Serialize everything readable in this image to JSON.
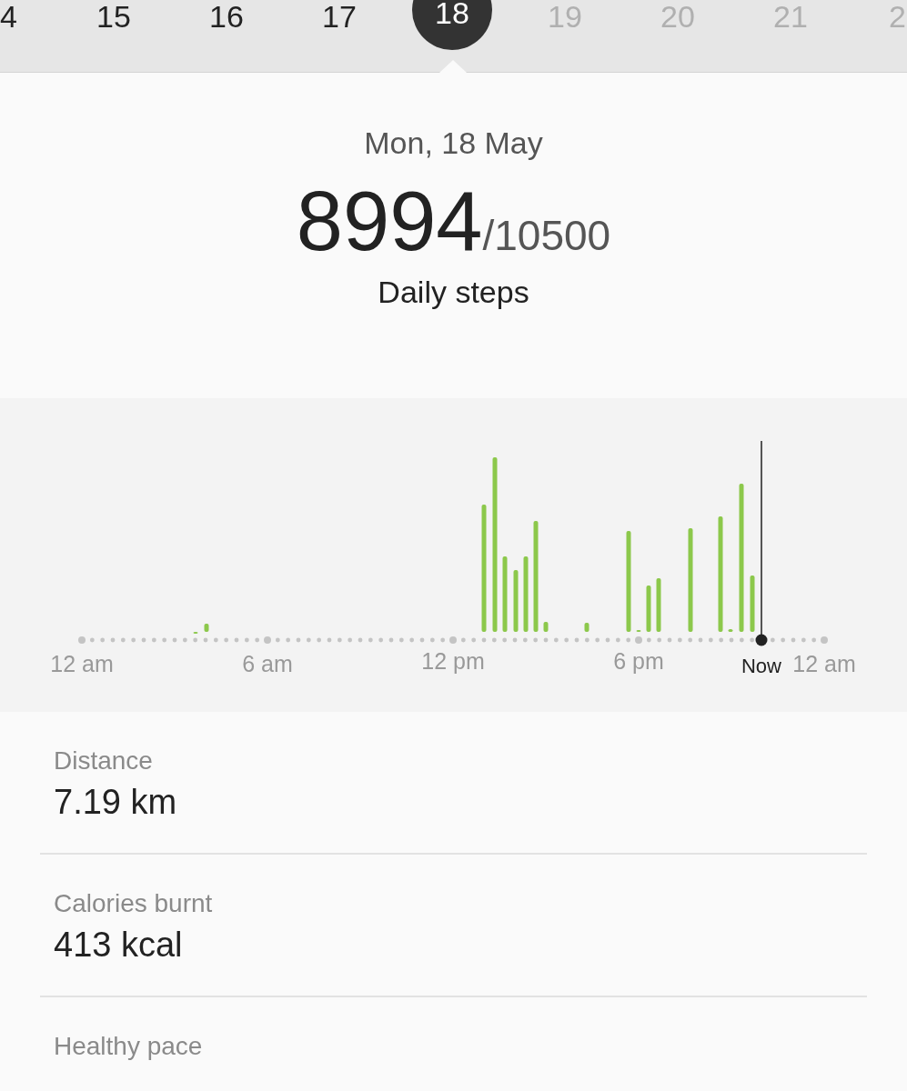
{
  "date_strip": [
    {
      "label": "4",
      "selected": false,
      "future": false
    },
    {
      "label": "15",
      "selected": false,
      "future": false
    },
    {
      "label": "16",
      "selected": false,
      "future": false
    },
    {
      "label": "17",
      "selected": false,
      "future": false
    },
    {
      "label": "18",
      "selected": true,
      "future": false
    },
    {
      "label": "19",
      "selected": false,
      "future": true
    },
    {
      "label": "20",
      "selected": false,
      "future": true
    },
    {
      "label": "21",
      "selected": false,
      "future": true
    },
    {
      "label": "2",
      "selected": false,
      "future": true
    }
  ],
  "summary": {
    "date": "Mon, 18 May",
    "steps": "8994",
    "goal": "/10500",
    "caption": "Daily steps"
  },
  "timeline": {
    "axis_labels": [
      "12 am",
      "6 am",
      "12 pm",
      "6 pm",
      "12 am"
    ],
    "now_label": "Now"
  },
  "stats": [
    {
      "label": "Distance",
      "value": "7.19 km"
    },
    {
      "label": "Calories burnt",
      "value": "413 kcal"
    },
    {
      "label": "Healthy pace"
    }
  ]
}
